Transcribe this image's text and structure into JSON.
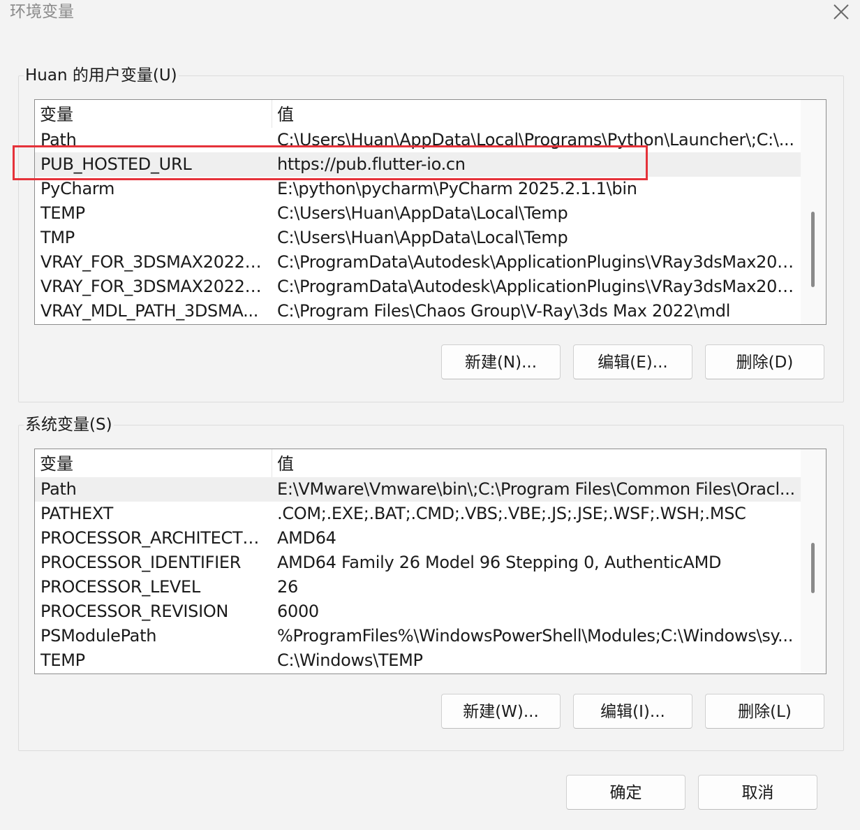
{
  "window": {
    "title": "环境变量",
    "close_icon": "close-icon"
  },
  "user_vars": {
    "group_label": "Huan 的用户变量(U)",
    "header_name": "变量",
    "header_value": "值",
    "rows": [
      {
        "name": "Path",
        "value": "C:\\Users\\Huan\\AppData\\Local\\Programs\\Python\\Launcher\\;C:\\..."
      },
      {
        "name": "PUB_HOSTED_URL",
        "value": "https://pub.flutter-io.cn"
      },
      {
        "name": "PyCharm",
        "value": "E:\\python\\pycharm\\PyCharm 2025.2.1.1\\bin"
      },
      {
        "name": "TEMP",
        "value": "C:\\Users\\Huan\\AppData\\Local\\Temp"
      },
      {
        "name": "TMP",
        "value": "C:\\Users\\Huan\\AppData\\Local\\Temp"
      },
      {
        "name": "VRAY_FOR_3DSMAX2022_...",
        "value": "C:\\ProgramData\\Autodesk\\ApplicationPlugins\\VRay3dsMax202..."
      },
      {
        "name": "VRAY_FOR_3DSMAX2022_...",
        "value": "C:\\ProgramData\\Autodesk\\ApplicationPlugins\\VRay3dsMax202..."
      },
      {
        "name": "VRAY_MDL_PATH_3DSMA...",
        "value": "C:\\Program Files\\Chaos Group\\V-Ray\\3ds Max 2022\\mdl"
      }
    ],
    "selected_index": 1,
    "buttons": {
      "new": "新建(N)...",
      "edit": "编辑(E)...",
      "delete": "删除(D)"
    }
  },
  "system_vars": {
    "group_label": "系统变量(S)",
    "header_name": "变量",
    "header_value": "值",
    "rows": [
      {
        "name": "Path",
        "value": "E:\\VMware\\Vmware\\bin\\;C:\\Program Files\\Common Files\\Oracl..."
      },
      {
        "name": "PATHEXT",
        "value": ".COM;.EXE;.BAT;.CMD;.VBS;.VBE;.JS;.JSE;.WSF;.WSH;.MSC"
      },
      {
        "name": "PROCESSOR_ARCHITECTU...",
        "value": "AMD64"
      },
      {
        "name": "PROCESSOR_IDENTIFIER",
        "value": "AMD64 Family 26 Model 96 Stepping 0, AuthenticAMD"
      },
      {
        "name": "PROCESSOR_LEVEL",
        "value": "26"
      },
      {
        "name": "PROCESSOR_REVISION",
        "value": "6000"
      },
      {
        "name": "PSModulePath",
        "value": "%ProgramFiles%\\WindowsPowerShell\\Modules;C:\\Windows\\sy..."
      },
      {
        "name": "TEMP",
        "value": "C:\\Windows\\TEMP"
      }
    ],
    "selected_index": 0,
    "buttons": {
      "new": "新建(W)...",
      "edit": "编辑(I)...",
      "delete": "删除(L)"
    }
  },
  "footer": {
    "ok": "确定",
    "cancel": "取消"
  },
  "annotation": {
    "highlight_color": "#e5323a"
  }
}
